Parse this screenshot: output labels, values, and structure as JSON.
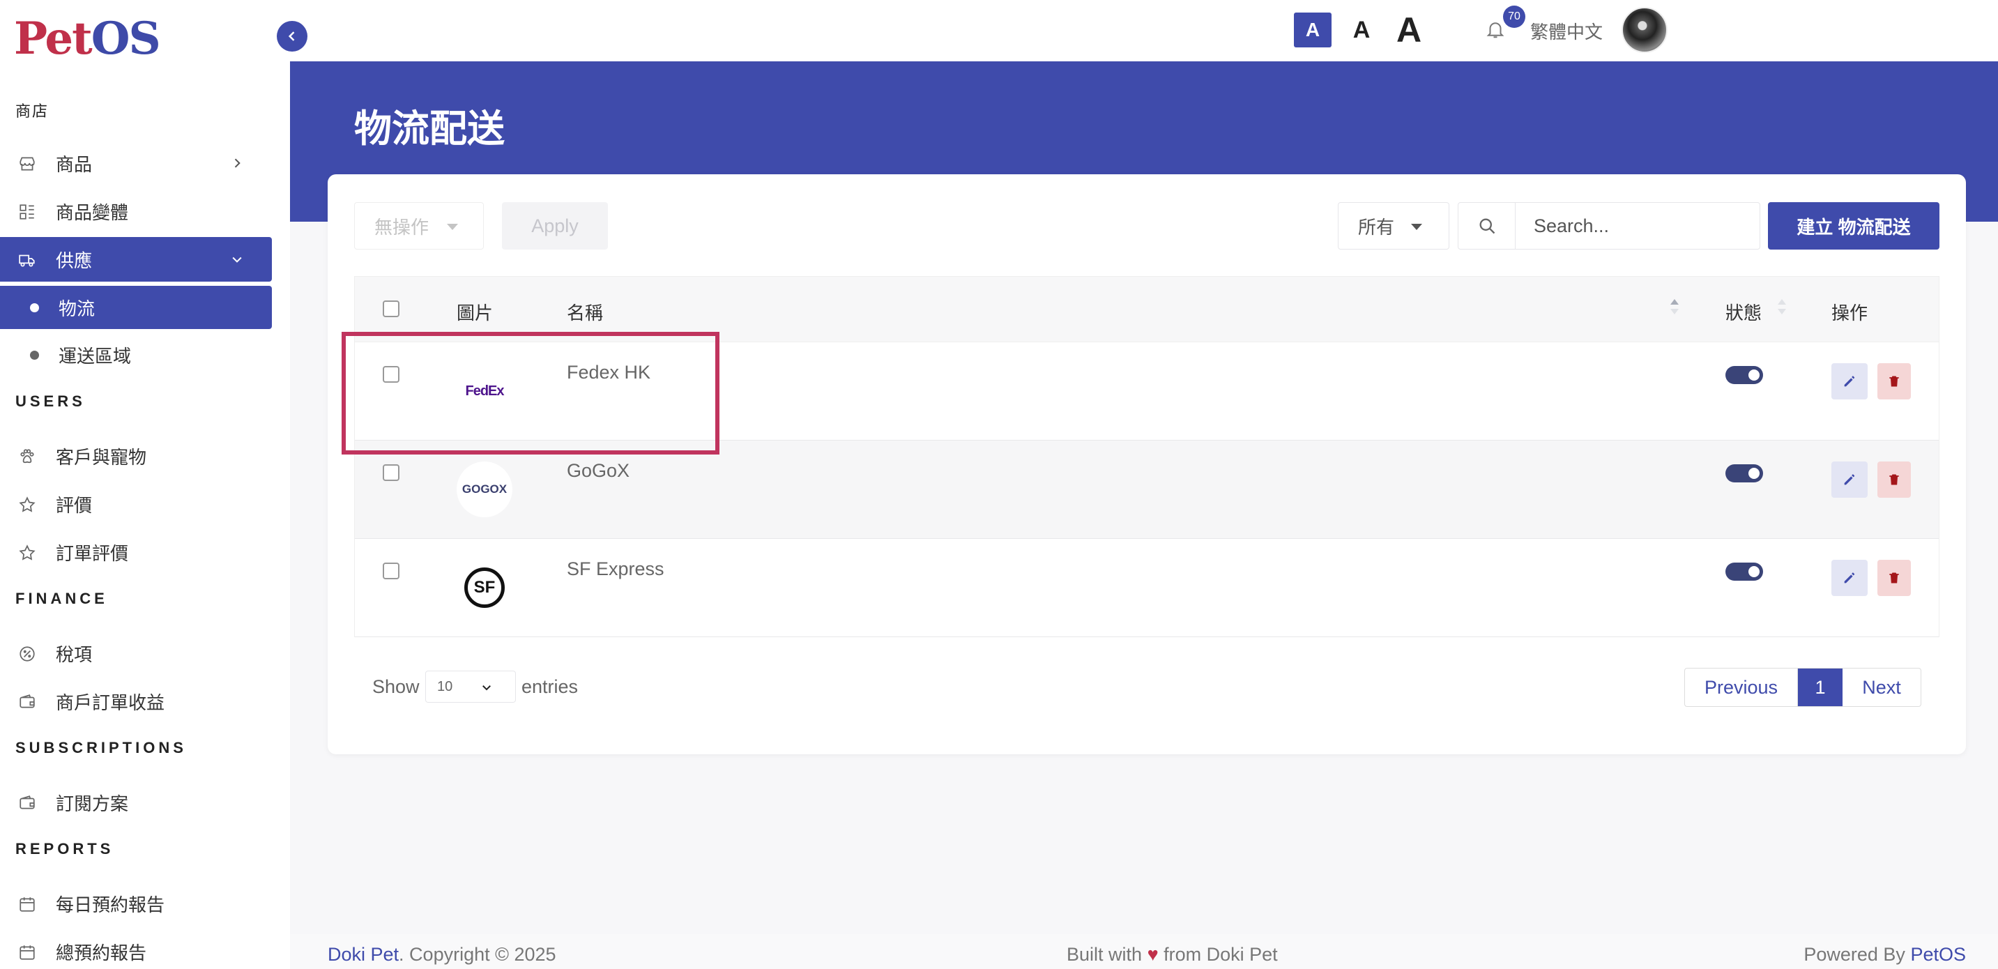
{
  "app": {
    "logo_part1": "Pet",
    "logo_part2": "OS",
    "brand_colors": {
      "primary": "#3f4bab",
      "accent": "#c0304a"
    }
  },
  "sidebar": {
    "section_store": "商店",
    "items_store": [
      {
        "label": "商品",
        "icon": "store-icon",
        "has_chevron": "right"
      },
      {
        "label": "商品變體",
        "icon": "variants-icon"
      },
      {
        "label": "供應",
        "icon": "truck-icon",
        "has_chevron": "down",
        "active": true
      }
    ],
    "sub_items": [
      {
        "label": "物流",
        "active": true
      },
      {
        "label": "運送區域"
      }
    ],
    "section_users": "USERS",
    "items_users": [
      {
        "label": "客戶與寵物",
        "icon": "paw-icon"
      },
      {
        "label": "評價",
        "icon": "star-icon"
      },
      {
        "label": "訂單評價",
        "icon": "star-icon"
      }
    ],
    "section_finance": "FINANCE",
    "items_finance": [
      {
        "label": "稅項",
        "icon": "tax-icon"
      },
      {
        "label": "商戶訂單收益",
        "icon": "wallet-icon"
      }
    ],
    "section_subscriptions": "SUBSCRIPTIONS",
    "items_subscriptions": [
      {
        "label": "訂閱方案",
        "icon": "wallet-icon"
      }
    ],
    "section_reports": "REPORTS",
    "items_reports": [
      {
        "label": "每日預約報告",
        "icon": "calendar-icon"
      },
      {
        "label": "總預約報告",
        "icon": "calendar-icon"
      }
    ]
  },
  "topbar": {
    "font_small": "A",
    "font_mid": "A",
    "font_large": "A",
    "notification_count": "70",
    "language": "繁體中文"
  },
  "page": {
    "title": "物流配送"
  },
  "toolbar": {
    "bulk_action": "無操作",
    "apply": "Apply",
    "filter": "所有",
    "search_placeholder": "Search...",
    "create": "建立 物流配送"
  },
  "table": {
    "headers": {
      "image": "圖片",
      "name": "名稱",
      "status": "狀態",
      "actions": "操作"
    },
    "rows": [
      {
        "name": "Fedex HK",
        "logo": "FedEx",
        "status_on": true
      },
      {
        "name": "GoGoX",
        "logo": "GOGOX",
        "status_on": true
      },
      {
        "name": "SF Express",
        "logo": "SF",
        "status_on": true
      }
    ]
  },
  "pagination": {
    "show": "Show",
    "page_length": "10",
    "entries": "entries",
    "previous": "Previous",
    "current": "1",
    "next": "Next"
  },
  "footer": {
    "brand": "Doki Pet",
    "copyright": ". Copyright © 2025",
    "built_prefix": "Built with",
    "heart": "♥",
    "built_suffix": "from Doki Pet",
    "powered_prefix": "Powered By",
    "powered_brand": "PetOS"
  }
}
